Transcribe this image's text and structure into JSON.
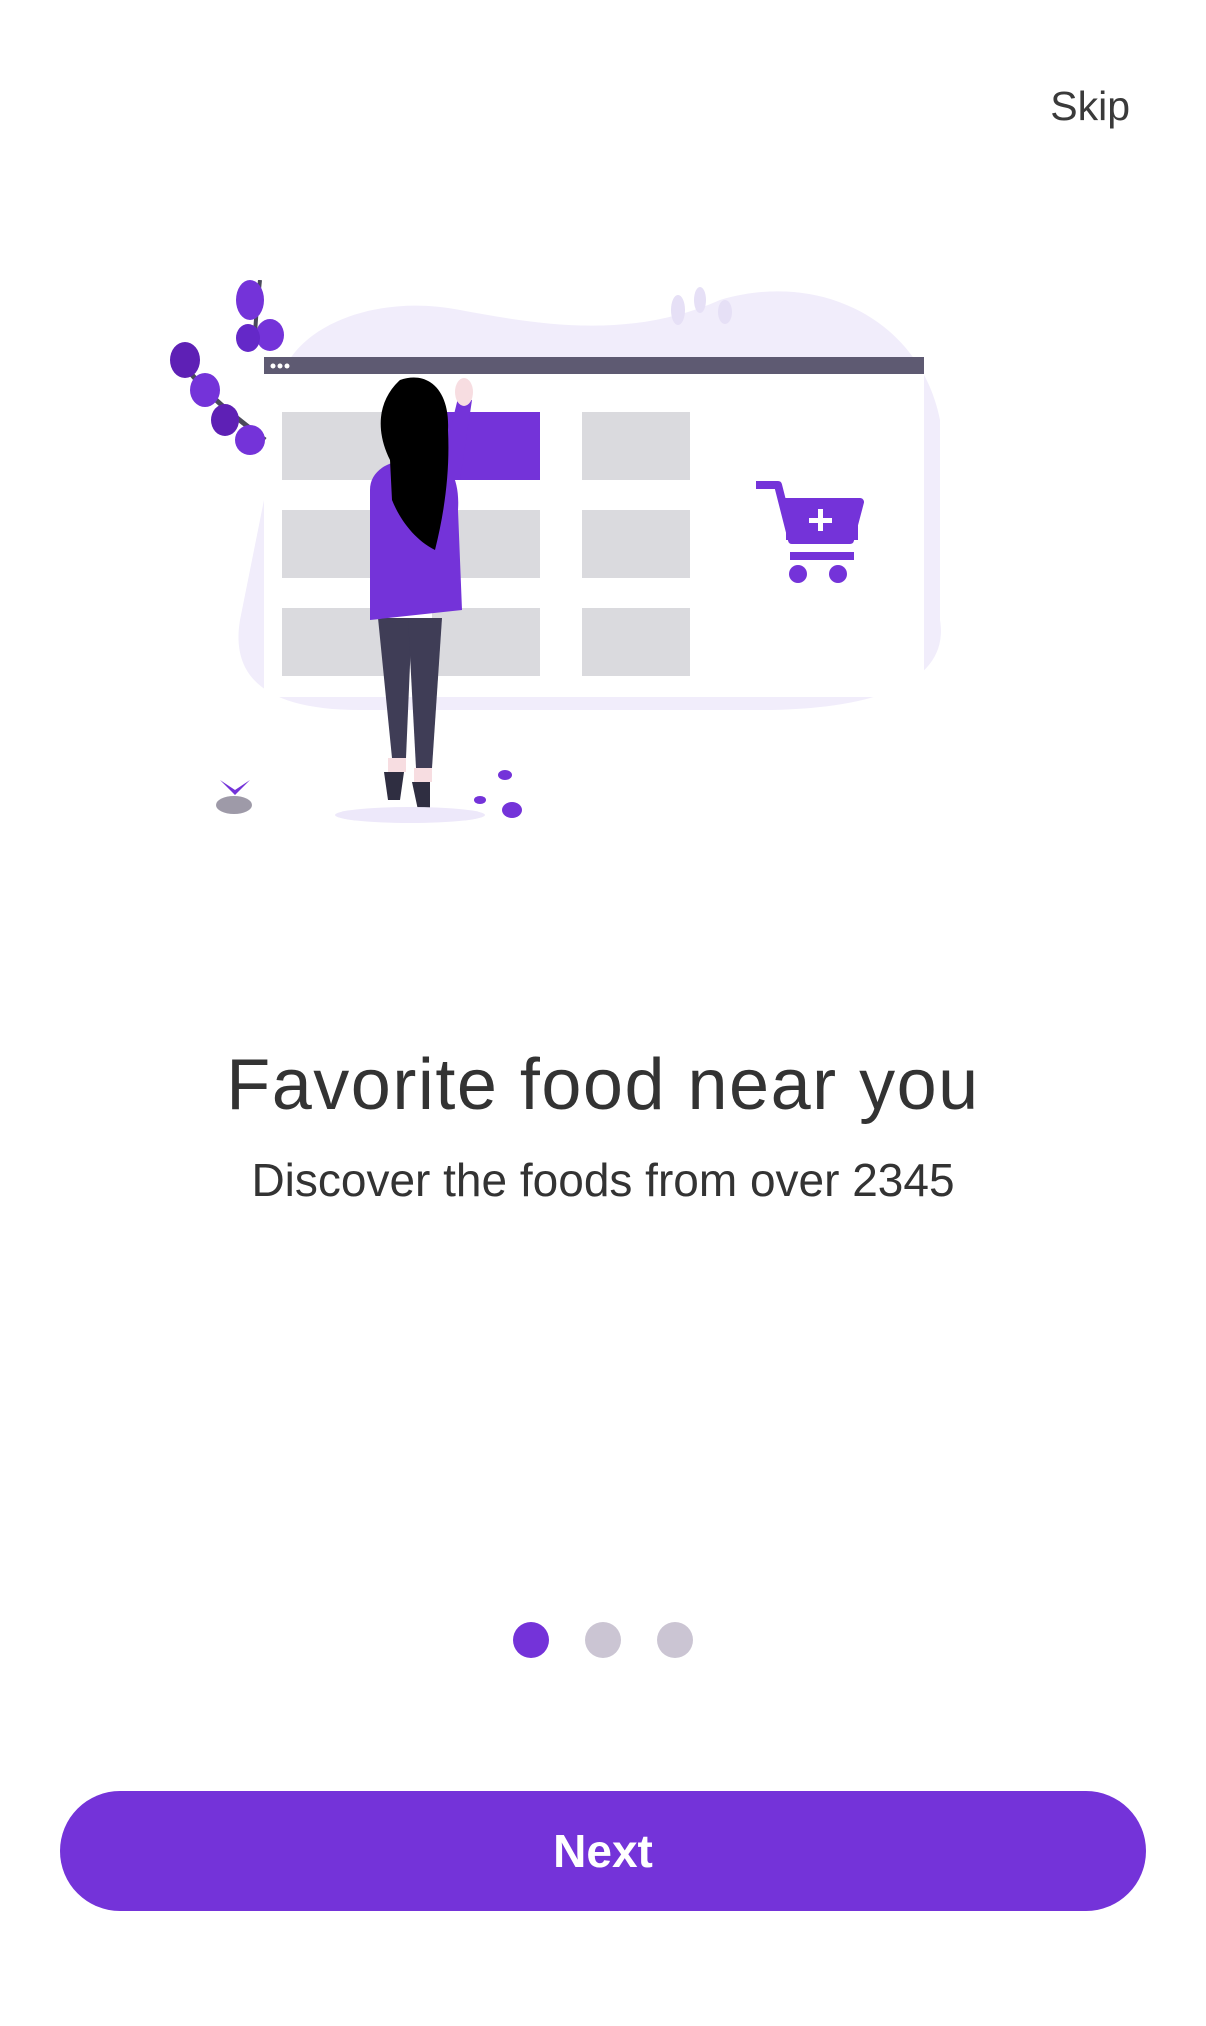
{
  "header": {
    "skip_label": "Skip"
  },
  "onboarding": {
    "title": "Favorite food near you",
    "subtitle": "Discover the foods from over 2345",
    "illustration": "woman-browsing-online-store-illustration"
  },
  "pager": {
    "total": 3,
    "current": 1
  },
  "footer": {
    "next_label": "Next"
  },
  "colors": {
    "accent": "#7433D9",
    "dot_active": "#7433D9",
    "dot_inactive": "#CBC5D3",
    "text": "#333333",
    "background": "#FFFFFF"
  }
}
